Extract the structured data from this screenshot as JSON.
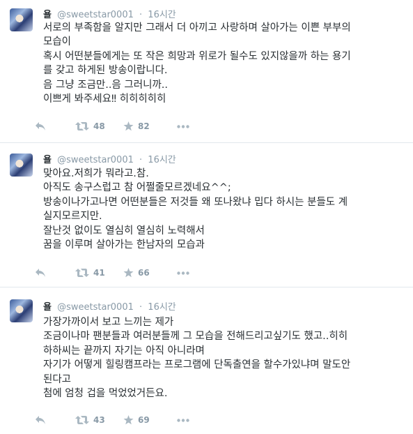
{
  "tweets": [
    {
      "name": "욜",
      "handle": "@sweetstar0001",
      "separator": "·",
      "time": "16시간",
      "lines": [
        "서로의 부족함을 알지만 그래서 더 아끼고 사랑하며 살아가는 이쁜 부부의",
        "모습이",
        "혹시 어떤분들에게는 또 작은 희망과 위로가 될수도 있지않을까 하는 용기",
        "를 갖고 하게된 방송이랍니다.",
        "음 그냥 조금만..음 그러니까..",
        "이쁘게 봐주세요‼ 히히히히히"
      ],
      "retweets": "48",
      "likes": "82"
    },
    {
      "name": "욜",
      "handle": "@sweetstar0001",
      "separator": "·",
      "time": "16시간",
      "lines": [
        "맞아요.저희가 뭐라고.참.",
        "아직도 송구스럽고 참 어쩔줄모르겠네요^^;",
        "방송이나가고나면 어떤분들은 저것들 왜 또나왔냐 밉다 하시는 분들도 계",
        "실지모르지만.",
        "잘난것 없이도 열심히 열심히 노력해서",
        "꿈을 이루며 살아가는 한남자의 모습과"
      ],
      "retweets": "41",
      "likes": "66"
    },
    {
      "name": "욜",
      "handle": "@sweetstar0001",
      "separator": "·",
      "time": "16시간",
      "lines": [
        "가장가까이서 보고 느끼는 제가",
        "조금이나마 팬분들과 여러분들께 그 모습을 전해드리고싶기도 했고..히히",
        "하하씨는 끝까지 자기는 아직 아니라며",
        "자기가 어떻게 힐링캠프라는 프로그램에 단독출연을 할수가있냐며 말도안",
        "된다고",
        "첨에 엄청 겁을 먹었었거든요."
      ],
      "retweets": "43",
      "likes": "69"
    }
  ],
  "icons": {
    "reply": "reply-icon",
    "retweet": "retweet-icon",
    "like": "star-icon",
    "more": "more-icon"
  },
  "colors": {
    "text": "#292f33",
    "muted": "#8899a6",
    "divider": "#e1e8ed"
  }
}
